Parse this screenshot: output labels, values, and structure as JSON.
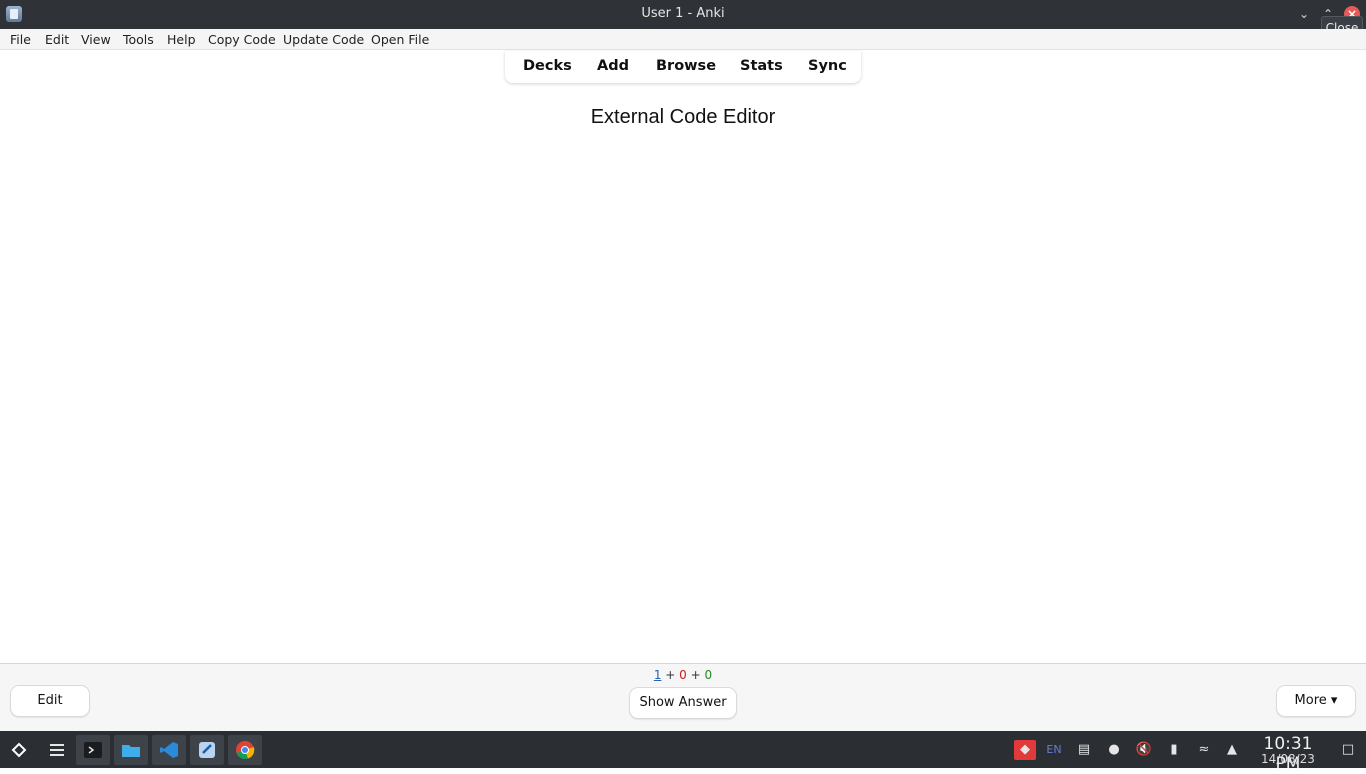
{
  "window": {
    "title": "User 1 - Anki",
    "tooltip": "Close"
  },
  "menu": [
    "File",
    "Edit",
    "View",
    "Tools",
    "Help",
    "Copy Code",
    "Update Code",
    "Open File"
  ],
  "nav": [
    "Decks",
    "Add",
    "Browse",
    "Stats",
    "Sync"
  ],
  "card": {
    "title": "External Code Editor"
  },
  "counts": {
    "new": "1",
    "learning": "0",
    "review": "0",
    "sep": "+"
  },
  "buttons": {
    "edit": "Edit",
    "show_answer": "Show Answer",
    "more": "More ▾"
  },
  "taskbar": {
    "apps": [
      "app-launcher-icon",
      "terminal-icon",
      "file-manager-icon",
      "vscode-icon",
      "anki-icon",
      "chrome-icon"
    ],
    "tray": {
      "language": "EN"
    },
    "clock": {
      "time": "10:31 PM",
      "date": "14/08/23"
    }
  },
  "colors": {
    "new": "#2a62b8",
    "learning": "#c42020",
    "review": "#1e8a1e",
    "close": "#e85a5a"
  }
}
